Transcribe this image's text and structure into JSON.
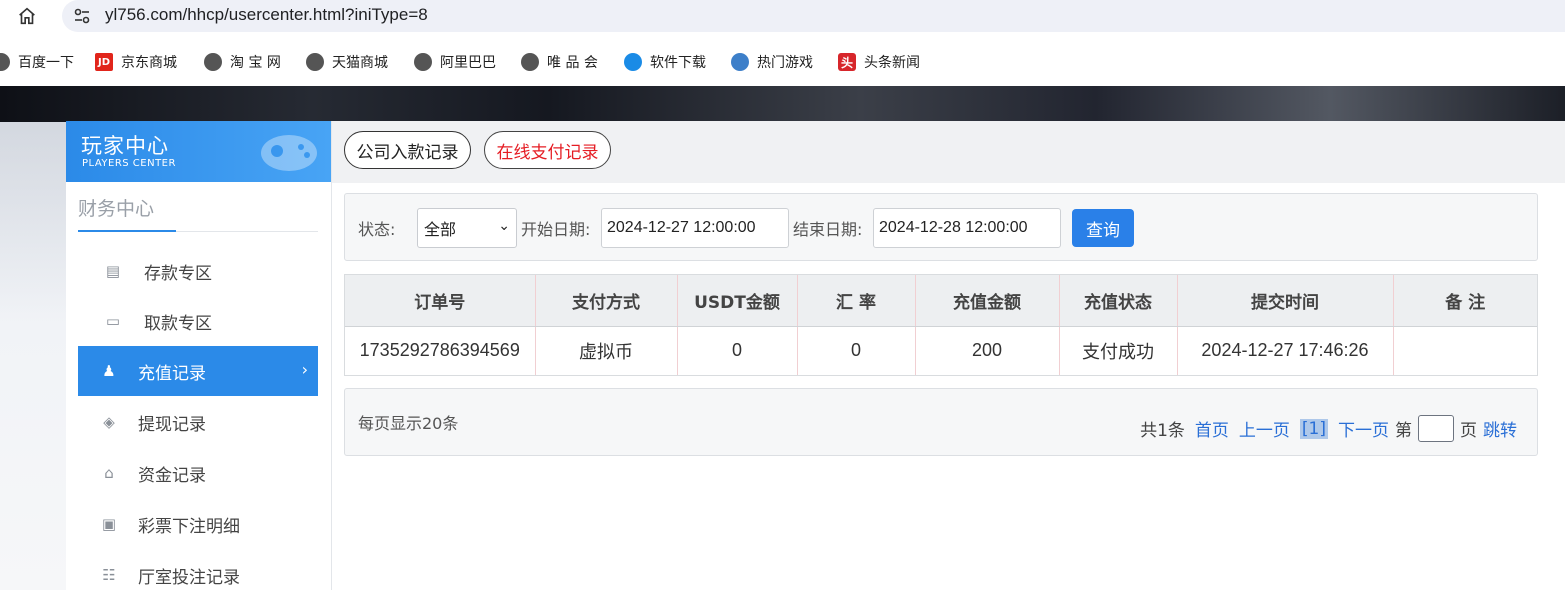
{
  "browser": {
    "url": "yl756.com/hhcp/usercenter.html?iniType=8",
    "bookmarks": [
      {
        "label": "百度一下",
        "icon": "globe-icon"
      },
      {
        "label": "京东商城",
        "icon": "jd-icon"
      },
      {
        "label": "淘 宝 网",
        "icon": "globe-icon"
      },
      {
        "label": "天猫商城",
        "icon": "globe-icon"
      },
      {
        "label": "阿里巴巴",
        "icon": "globe-icon"
      },
      {
        "label": "唯 品 会",
        "icon": "globe-icon"
      },
      {
        "label": "软件下载",
        "icon": "download-icon"
      },
      {
        "label": "热门游戏",
        "icon": "game-icon"
      },
      {
        "label": "头条新闻",
        "icon": "news-icon"
      }
    ]
  },
  "sidebar": {
    "title": "玩家中心",
    "subtitle": "PLAYERS CENTER",
    "section": "财务中心",
    "items": [
      {
        "label": "存款专区",
        "icon": "card-icon"
      },
      {
        "label": "取款专区",
        "icon": "cash-icon"
      },
      {
        "label": "充值记录",
        "icon": "moneybag-icon",
        "active": true
      },
      {
        "label": "提现记录",
        "icon": "withdraw-icon"
      },
      {
        "label": "资金记录",
        "icon": "fund-icon"
      },
      {
        "label": "彩票下注明细",
        "icon": "list-icon"
      },
      {
        "label": "厅室投注记录",
        "icon": "records-icon"
      }
    ]
  },
  "tabs": {
    "company": "公司入款记录",
    "online": "在线支付记录"
  },
  "filter": {
    "status_label": "状态:",
    "status_value": "全部",
    "start_label": "开始日期:",
    "start_value": "2024-12-27 12:00:00",
    "end_label": "结束日期:",
    "end_value": "2024-12-28 12:00:00",
    "query_button": "查询"
  },
  "table": {
    "headers": [
      "订单号",
      "支付方式",
      "USDT金额",
      "汇 率",
      "充值金额",
      "充值状态",
      "提交时间",
      "备 注"
    ],
    "rows": [
      [
        "1735292786394569",
        "虚拟币",
        "0",
        "0",
        "200",
        "支付成功",
        "2024-12-27 17:46:26",
        ""
      ]
    ]
  },
  "pager": {
    "per_page": "每页显示20条",
    "total": "共1条",
    "first": "首页",
    "prev": "上一页",
    "current": "[1]",
    "next": "下一页",
    "page_prefix": "第",
    "page_suffix": "页",
    "jump": "跳转"
  },
  "colors": {
    "accent": "#2b8ae8",
    "tab_red": "#e51c23",
    "link": "#2a6fd6"
  }
}
